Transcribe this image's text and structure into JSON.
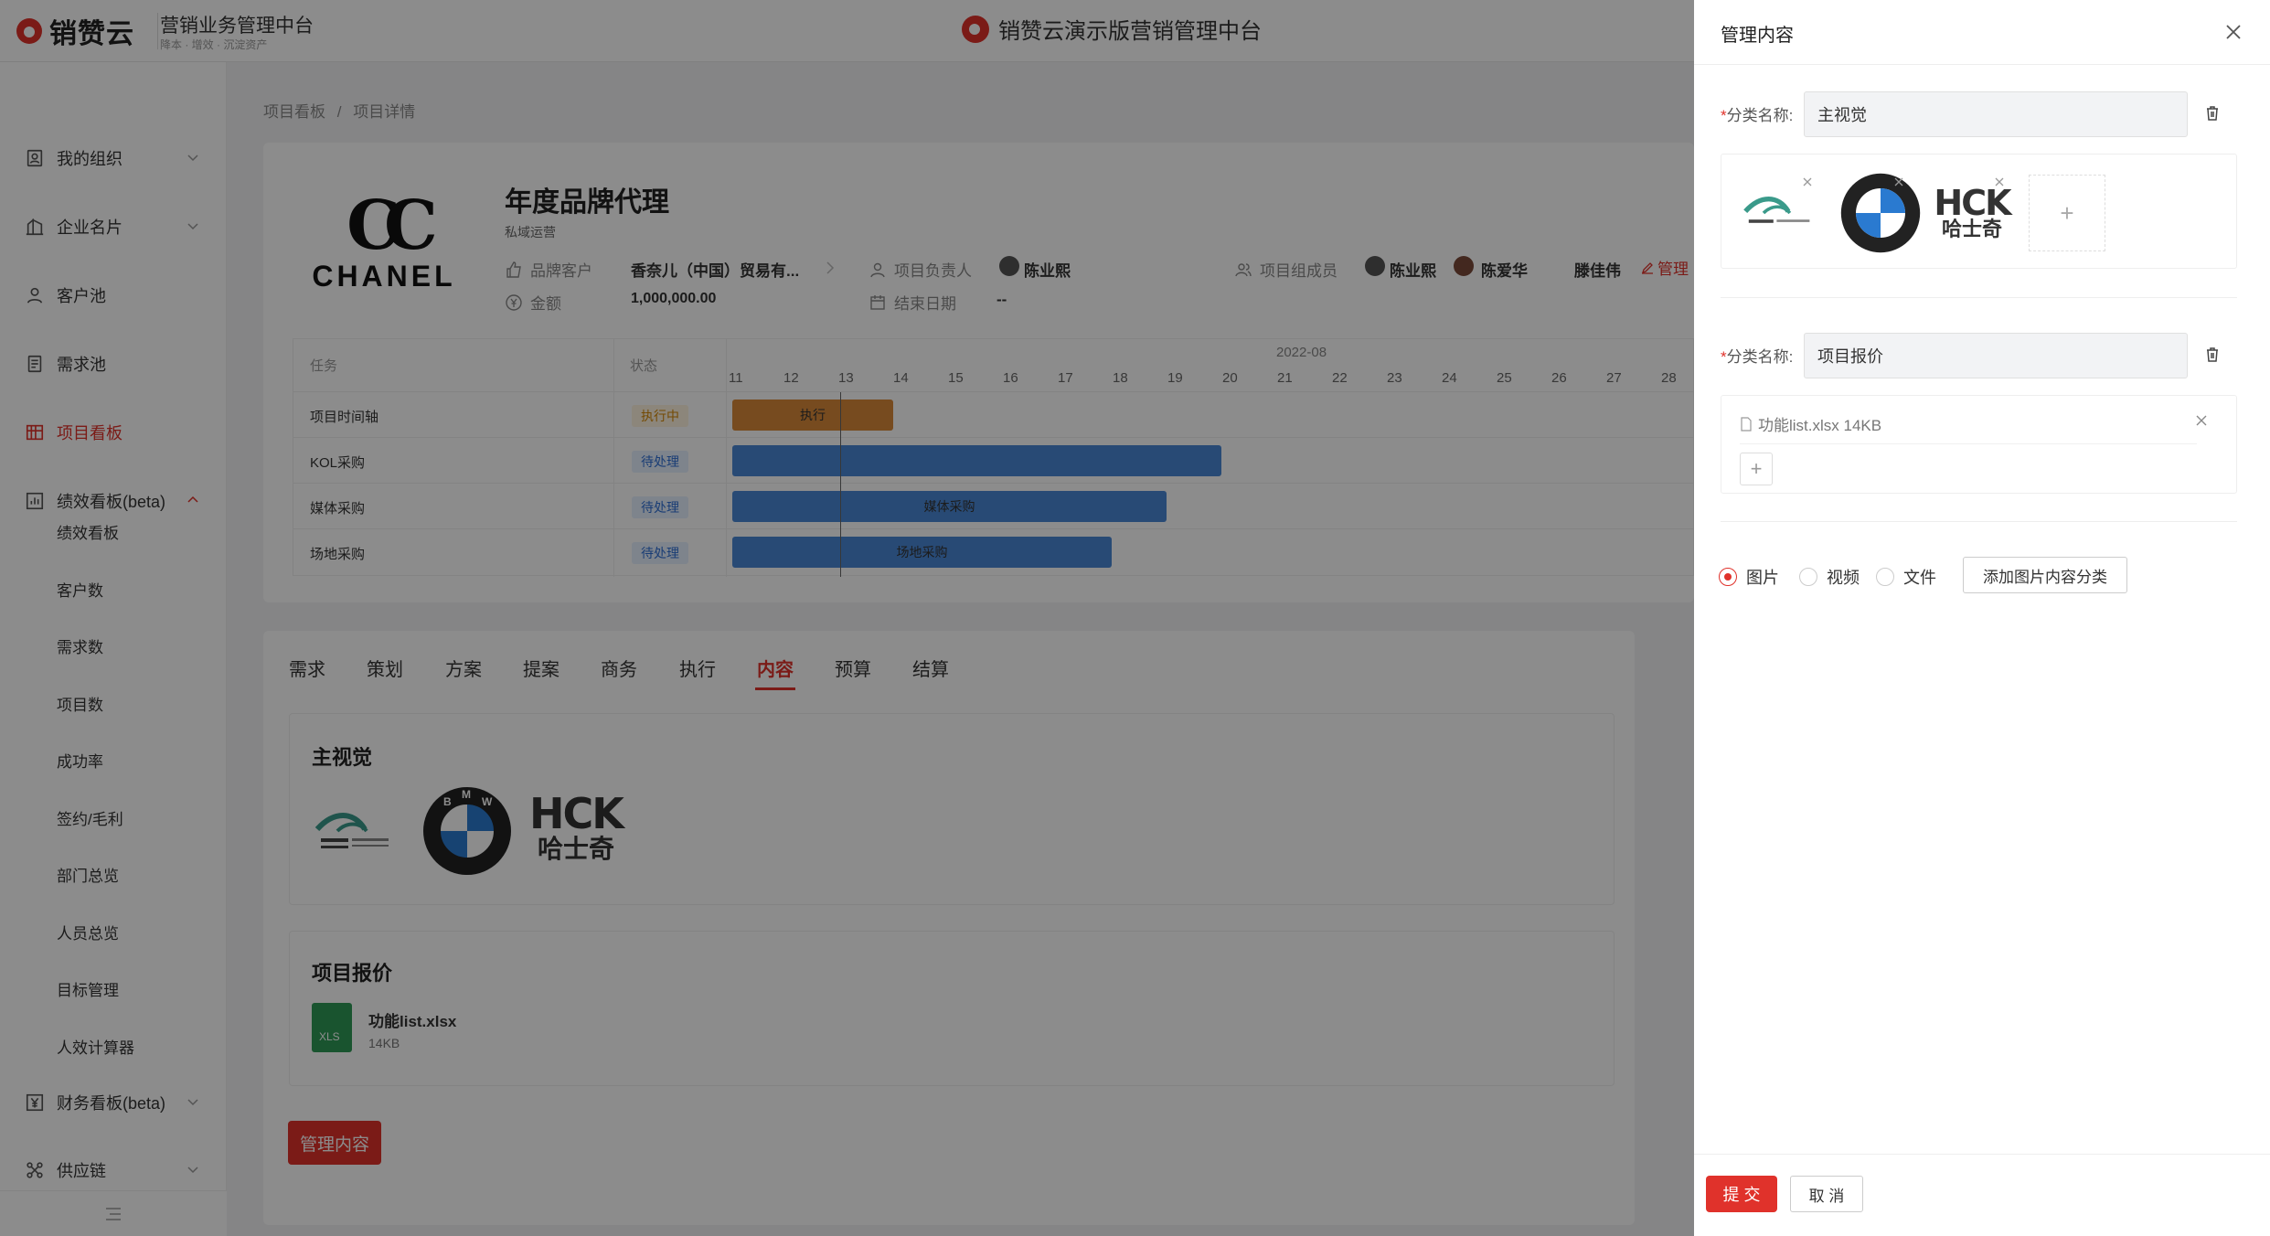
{
  "header": {
    "logo_text": "销赞云",
    "system_title": "营销业务管理中台",
    "system_sub": "降本 · 增效 · 沉淀资产",
    "center_title": "销赞云演示版营销管理中台"
  },
  "sidebar": {
    "items": [
      {
        "label": "我的组织",
        "icon": "org-icon"
      },
      {
        "label": "企业名片",
        "icon": "building-icon"
      },
      {
        "label": "客户池",
        "icon": "user-icon"
      },
      {
        "label": "需求池",
        "icon": "doc-icon"
      },
      {
        "label": "项目看板",
        "icon": "board-icon"
      },
      {
        "label": "绩效看板(beta)",
        "icon": "chart-icon"
      },
      {
        "label": "财务看板(beta)",
        "icon": "yen-icon"
      },
      {
        "label": "供应链",
        "icon": "supply-icon"
      }
    ],
    "sub_items": [
      "绩效看板",
      "客户数",
      "需求数",
      "项目数",
      "成功率",
      "签约/毛利",
      "部门总览",
      "人员总览",
      "目标管理",
      "人效计算器"
    ],
    "active_color": "#e0322b"
  },
  "breadcrumb": {
    "items": [
      "项目看板",
      "项目详情"
    ],
    "separator": "/"
  },
  "project": {
    "brand_logo_text": "CHANEL",
    "title": "年度品牌代理",
    "subtitle": "私域运营",
    "brand_customer_label": "品牌客户",
    "brand_customer_value": "香奈儿（中国）贸易有...",
    "amount_label": "金额",
    "amount_value": "1,000,000.00",
    "owner_label": "项目负责人",
    "owner_value": "陈业熙",
    "end_date_label": "结束日期",
    "end_date_value": "--",
    "members_label": "项目组成员",
    "members": [
      "陈业熙",
      "陈爱华",
      "滕佳伟"
    ],
    "manage_link": "管理"
  },
  "gantt": {
    "col_task": "任务",
    "col_status": "状态",
    "month": "2022-08",
    "days": [
      "11",
      "12",
      "13",
      "14",
      "15",
      "16",
      "17",
      "18",
      "19",
      "20",
      "21",
      "22",
      "23",
      "24",
      "25",
      "26",
      "27",
      "28"
    ],
    "rows": [
      {
        "task": "项目时间轴",
        "status": "执行中",
        "bar_label": "执行"
      },
      {
        "task": "KOL采购",
        "status": "待处理",
        "bar_label": ""
      },
      {
        "task": "媒体采购",
        "status": "待处理",
        "bar_label": "媒体采购"
      },
      {
        "task": "场地采购",
        "status": "待处理",
        "bar_label": "场地采购"
      }
    ]
  },
  "tabs": {
    "items": [
      "需求",
      "策划",
      "方案",
      "提案",
      "商务",
      "执行",
      "内容",
      "预算",
      "结算"
    ],
    "active": "内容"
  },
  "content": {
    "section1_title": "主视觉",
    "section2_title": "项目报价",
    "file_name": "功能list.xlsx",
    "file_size": "14KB",
    "file_badge": "XLS",
    "manage_button": "管理内容",
    "hck_text": "HCK",
    "hck_sub": "哈士奇",
    "bmw_letters": "BMW"
  },
  "drawer": {
    "title": "管理内容",
    "category_label": "分类名称:",
    "category1_value": "主视觉",
    "category2_value": "项目报价",
    "file_item": "功能list.xlsx  14KB",
    "radio_options": [
      "图片",
      "视频",
      "文件"
    ],
    "radio_selected": "图片",
    "add_category_button": "添加图片内容分类",
    "submit_button": "提 交",
    "cancel_button": "取 消"
  }
}
